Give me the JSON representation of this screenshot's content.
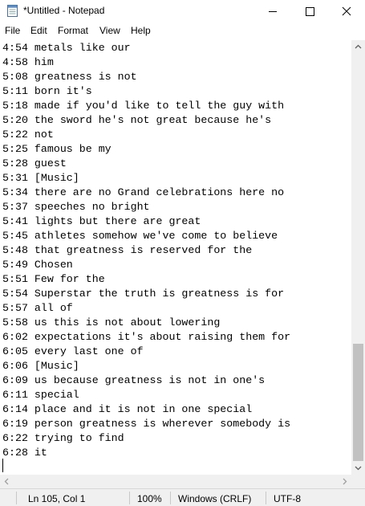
{
  "window": {
    "title": "*Untitled - Notepad"
  },
  "menu": [
    "File",
    "Edit",
    "Format",
    "View",
    "Help"
  ],
  "editor": {
    "lines": [
      "4:54 metals like our",
      "4:58 him",
      "5:08 greatness is not",
      "5:11 born it's",
      "5:18 made if you'd like to tell the guy with",
      "5:20 the sword he's not great because he's",
      "5:22 not",
      "5:25 famous be my",
      "5:28 guest",
      "5:31 [Music]",
      "5:34 there are no Grand celebrations here no",
      "5:37 speeches no bright",
      "5:41 lights but there are great",
      "5:45 athletes somehow we've come to believe",
      "5:48 that greatness is reserved for the",
      "5:49 Chosen",
      "5:51 Few for the",
      "5:54 Superstar the truth is greatness is for",
      "5:57 all of",
      "5:58 us this is not about lowering",
      "6:02 expectations it's about raising them for",
      "6:05 every last one of",
      "6:06 [Music]",
      "6:09 us because greatness is not in one's",
      "6:11 special",
      "6:14 place and it is not in one special",
      "6:19 person greatness is wherever somebody is",
      "6:22 trying to find",
      "6:28 it"
    ]
  },
  "status": {
    "position": "Ln 105, Col 1",
    "zoom": "100%",
    "line_ending": "Windows (CRLF)",
    "encoding": "UTF-8"
  }
}
